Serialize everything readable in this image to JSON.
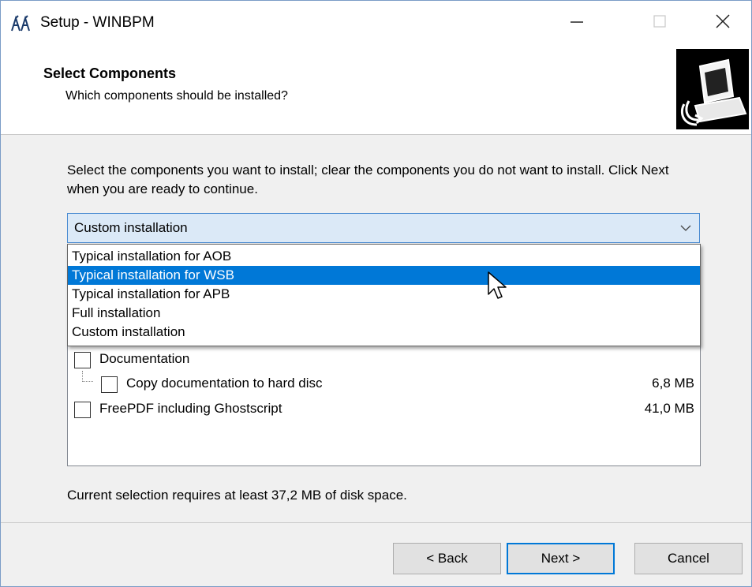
{
  "window": {
    "title": "Setup - WINBPM",
    "minimize_icon": "minimize-icon",
    "maximize_icon": "maximize-icon",
    "close_icon": "close-icon"
  },
  "header": {
    "title": "Select Components",
    "subtitle": "Which components should be installed?",
    "image_icon": "computer-install-icon"
  },
  "instructions": "Select the components you want to install; clear the components you do not want to install. Click Next when you are ready to continue.",
  "install_type": {
    "selected": "Custom installation",
    "options": [
      "Typical installation for AOB",
      "Typical installation for WSB",
      "Typical installation for APB",
      "Full installation",
      "Custom installation"
    ],
    "highlighted_index": 1
  },
  "components": [
    {
      "label": "Documentation",
      "size": "",
      "checked": false,
      "level": 0
    },
    {
      "label": "Copy documentation to hard disc",
      "size": "6,8 MB",
      "checked": false,
      "level": 1
    },
    {
      "label": "FreePDF including Ghostscript",
      "size": "41,0 MB",
      "checked": false,
      "level": 0
    }
  ],
  "disk_space": "Current selection requires at least 37,2 MB of disk space.",
  "buttons": {
    "back": "< Back",
    "next": "Next >",
    "cancel": "Cancel"
  },
  "colors": {
    "accent": "#0078d7",
    "combo_bg": "#dbe9f7",
    "dialog_bg": "#f0f0f0"
  }
}
